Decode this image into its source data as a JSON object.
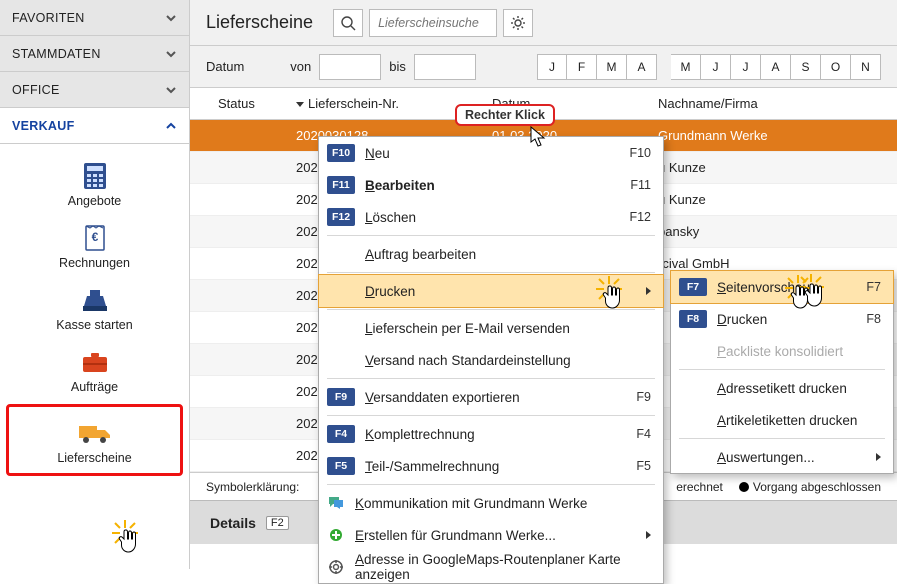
{
  "sidebar": {
    "sections": [
      {
        "label": "FAVORITEN",
        "open": false
      },
      {
        "label": "STAMMDATEN",
        "open": false
      },
      {
        "label": "OFFICE",
        "open": false
      },
      {
        "label": "VERKAUF",
        "open": true
      }
    ],
    "verkauf_items": [
      {
        "label": "Angebote",
        "icon": "calculator"
      },
      {
        "label": "Rechnungen",
        "icon": "invoice"
      },
      {
        "label": "Kasse starten",
        "icon": "cashregister"
      },
      {
        "label": "Aufträge",
        "icon": "briefcase"
      },
      {
        "label": "Lieferscheine",
        "icon": "truck"
      }
    ]
  },
  "header": {
    "title": "Lieferscheine",
    "search_placeholder": "Lieferscheinsuche",
    "date_label": "Datum",
    "from_label": "von",
    "to_label": "bis",
    "months": [
      "J",
      "F",
      "M",
      "A",
      "M",
      "J",
      "J",
      "A",
      "S",
      "O",
      "N"
    ]
  },
  "columns": {
    "status": "Status",
    "nr": "Lieferschein-Nr.",
    "date": "Datum",
    "name": "Nachname/Firma"
  },
  "rows": [
    {
      "status": "red",
      "nr": "2020030128",
      "date": "01.03.2020",
      "name": "Grundmann Werke",
      "sel": true
    },
    {
      "status": "red",
      "nr": "202",
      "name_suffix": "u Kunze"
    },
    {
      "status": "red",
      "nr": "202",
      "name_suffix": "u Kunze"
    },
    {
      "status": "red",
      "nr": "202",
      "name_suffix": "bansky"
    },
    {
      "status": "green",
      "nr": "202",
      "name_suffix": "rcival GmbH"
    },
    {
      "status": "green",
      "nr": "202"
    },
    {
      "status": "green",
      "nr": "202"
    },
    {
      "status": "green",
      "nr": "202"
    },
    {
      "status": "green",
      "nr": "202"
    },
    {
      "status": "green",
      "nr": "202"
    },
    {
      "status": "green",
      "nr": "202"
    }
  ],
  "legend": {
    "label": "Symbolerklärung:",
    "item_right1": "erechnet",
    "item_right2": "Vorgang abgeschlossen"
  },
  "details": {
    "label": "Details",
    "key": "F2"
  },
  "bubble": "Rechter Klick",
  "ctx1": {
    "items": [
      {
        "badge": "F10",
        "text": "Neu",
        "key": "F10"
      },
      {
        "badge": "F11",
        "text": "Bearbeiten",
        "key": "F11",
        "bold": true
      },
      {
        "badge": "F12",
        "text": "Löschen",
        "key": "F12"
      },
      {
        "sep": true
      },
      {
        "text": "Auftrag bearbeiten"
      },
      {
        "sep": true
      },
      {
        "text": "Drucken",
        "sub": true,
        "hover": true
      },
      {
        "sep": true
      },
      {
        "text": "Lieferschein per E-Mail versenden"
      },
      {
        "text": "Versand nach Standardeinstellung"
      },
      {
        "sep": true
      },
      {
        "badge": "F9",
        "text": "Versanddaten exportieren",
        "key": "F9"
      },
      {
        "sep": true
      },
      {
        "badge": "F4",
        "text": "Komplettrechnung",
        "key": "F4"
      },
      {
        "badge": "F5",
        "text": "Teil-/Sammelrechnung",
        "key": "F5"
      },
      {
        "sep": true
      },
      {
        "icon": "chat",
        "text": "Kommunikation mit Grundmann Werke"
      },
      {
        "icon": "plus",
        "text": "Erstellen für Grundmann Werke...",
        "sub": true
      },
      {
        "icon": "target",
        "text": "Adresse in GoogleMaps-Routenplaner Karte anzeigen"
      }
    ]
  },
  "ctx2": {
    "items": [
      {
        "badge": "F7",
        "text": "Seitenvorschau",
        "key": "F7",
        "hover": true
      },
      {
        "badge": "F8",
        "text": "Drucken",
        "key": "F8"
      },
      {
        "text": "Packliste konsolidiert",
        "disabled": true
      },
      {
        "sep": true
      },
      {
        "text": "Adressetikett drucken"
      },
      {
        "text": "Artikeletiketten drucken"
      },
      {
        "sep": true
      },
      {
        "text": "Auswertungen...",
        "sub": true
      }
    ]
  }
}
